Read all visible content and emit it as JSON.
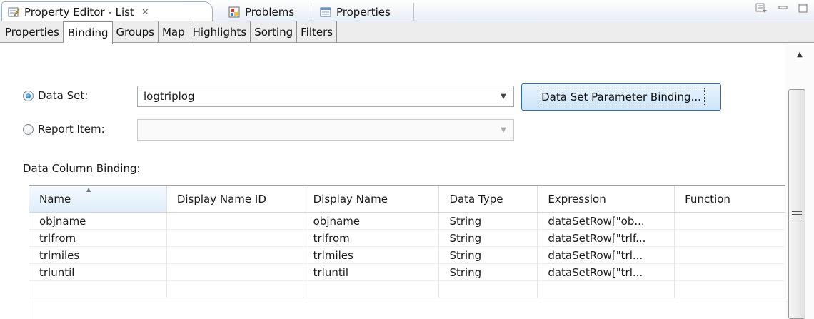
{
  "view_tabs": [
    {
      "label": "Property Editor - List",
      "icon": "property-editor-icon",
      "active": true
    },
    {
      "label": "Problems",
      "icon": "problems-icon",
      "active": false
    },
    {
      "label": "Properties",
      "icon": "properties-icon",
      "active": false
    }
  ],
  "sub_tabs": [
    "Properties",
    "Binding",
    "Groups",
    "Map",
    "Highlights",
    "Sorting",
    "Filters"
  ],
  "active_sub_tab": "Binding",
  "binding": {
    "data_set_label": "Data Set:",
    "data_set_value": "logtriplog",
    "report_item_label": "Report Item:",
    "report_item_value": "",
    "param_button_label": "Data Set Parameter Binding...",
    "column_binding_label": "Data Column Binding:"
  },
  "table": {
    "columns": [
      "Name",
      "Display Name ID",
      "Display Name",
      "Data Type",
      "Expression",
      "Function"
    ],
    "rows": [
      [
        "objname",
        "",
        "objname",
        "String",
        "dataSetRow[\"ob...",
        ""
      ],
      [
        "trlfrom",
        "",
        "trlfrom",
        "String",
        "dataSetRow[\"trlf...",
        ""
      ],
      [
        "trlmiles",
        "",
        "trlmiles",
        "String",
        "dataSetRow[\"trl...",
        ""
      ],
      [
        "trluntil",
        "",
        "trluntil",
        "String",
        "dataSetRow[\"trl...",
        ""
      ]
    ]
  },
  "colors": {
    "accent": "#2a6db5",
    "tab_border": "#9fb1c8"
  }
}
